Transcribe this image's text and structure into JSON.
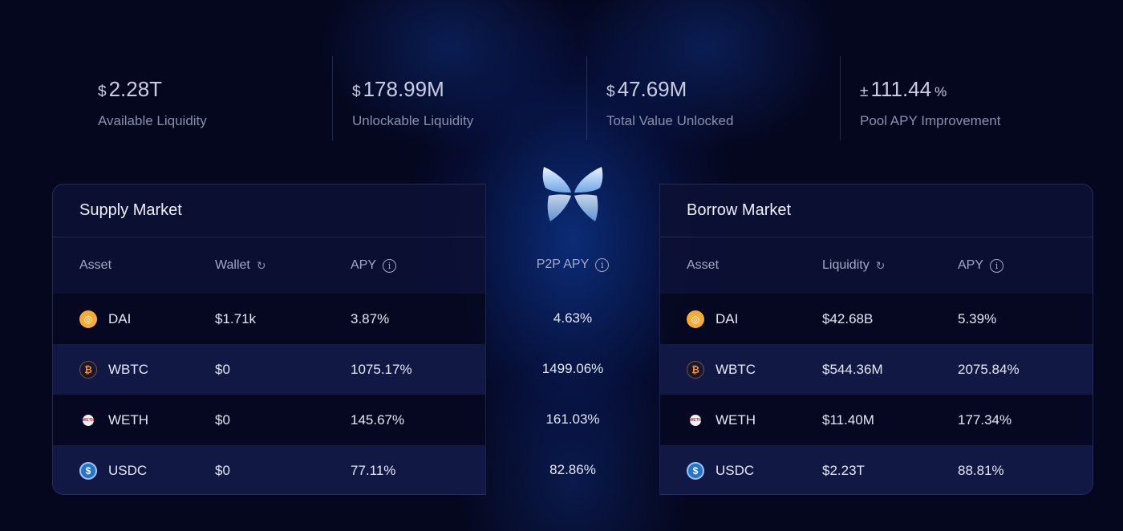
{
  "stats": [
    {
      "prefix": "$",
      "value": "2.28T",
      "suffix": "",
      "label": "Available Liquidity"
    },
    {
      "prefix": "$",
      "value": "178.99M",
      "suffix": "",
      "label": "Unlockable Liquidity"
    },
    {
      "prefix": "$",
      "value": "47.69M",
      "suffix": "",
      "label": "Total Value Unlocked"
    },
    {
      "prefix": "±",
      "value": "111.44",
      "suffix": "%",
      "label": "Pool APY Improvement"
    }
  ],
  "supply": {
    "title": "Supply Market",
    "headers": [
      "Asset",
      "Wallet",
      "APY"
    ],
    "rows": [
      {
        "asset": "DAI",
        "col2": "$1.71k",
        "apy": "3.87%"
      },
      {
        "asset": "WBTC",
        "col2": "$0",
        "apy": "1075.17%"
      },
      {
        "asset": "WETH",
        "col2": "$0",
        "apy": "145.67%"
      },
      {
        "asset": "USDC",
        "col2": "$0",
        "apy": "77.11%"
      }
    ]
  },
  "p2p": {
    "header": "P2P APY",
    "values": [
      "4.63%",
      "1499.06%",
      "161.03%",
      "82.86%"
    ]
  },
  "borrow": {
    "title": "Borrow Market",
    "headers": [
      "Asset",
      "Liquidity",
      "APY"
    ],
    "rows": [
      {
        "asset": "DAI",
        "col2": "$42.68B",
        "apy": "5.39%"
      },
      {
        "asset": "WBTC",
        "col2": "$544.36M",
        "apy": "2075.84%"
      },
      {
        "asset": "WETH",
        "col2": "$11.40M",
        "apy": "177.34%"
      },
      {
        "asset": "USDC",
        "col2": "$2.23T",
        "apy": "88.81%"
      }
    ]
  },
  "icons": {
    "dai": {
      "glyph": "◎",
      "color": "#f5ac37"
    },
    "wbtc": {
      "glyph": "₿",
      "color": "#f7931a"
    },
    "weth": {
      "glyph": "WETH",
      "color": "#c0263a"
    },
    "usdc": {
      "glyph": "$",
      "color": "#2775ca"
    },
    "info": "i",
    "refresh": "↻"
  },
  "colors": {
    "background": "#05071f",
    "panel": "#0c1034",
    "glow": "#104abe"
  }
}
